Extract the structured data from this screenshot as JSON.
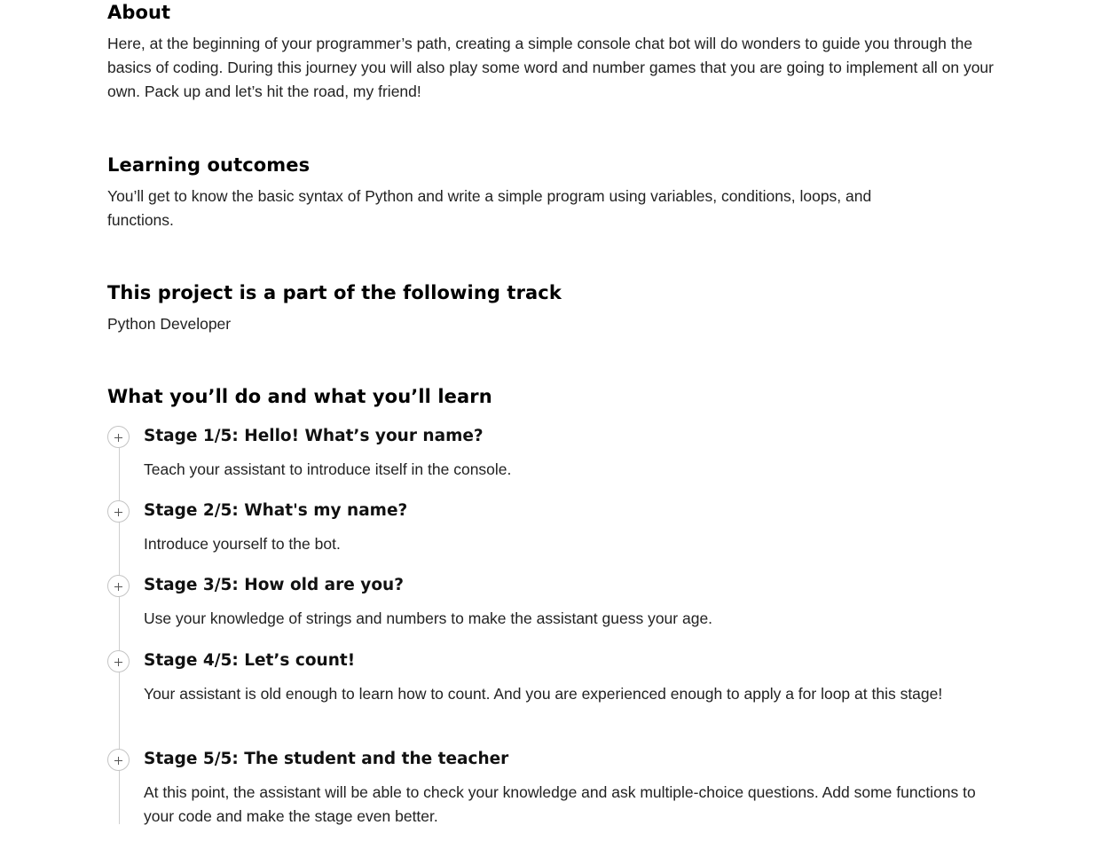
{
  "about": {
    "heading": "About",
    "text": "Here, at the beginning of your programmer’s path, creating a simple console chat bot will do wonders to guide you through the basics of coding. During this journey you will also play some word and number games that you are going to implement all on your own. Pack up and let’s hit the road, my friend!"
  },
  "outcomes": {
    "heading": "Learning outcomes",
    "text": "You’ll get to know the basic syntax of Python and write a simple program using variables, conditions, loops, and functions."
  },
  "track": {
    "heading": "This project is a part of the following track",
    "name": "Python Developer"
  },
  "stages": {
    "heading": "What you’ll do and what you’ll learn",
    "toggle_icon": "plus-circle-icon",
    "items": [
      {
        "title": "Stage 1/5: Hello! What’s your name?",
        "description": "Teach your assistant to introduce itself in the console."
      },
      {
        "title": "Stage 2/5: What's my name?",
        "description": "Introduce yourself to the bot."
      },
      {
        "title": "Stage 3/5: How old are you?",
        "description": "Use your knowledge of strings and numbers to make the assistant guess your age."
      },
      {
        "title": "Stage 4/5: Let’s count!",
        "description": "Your assistant is old enough to learn how to count. And you are experienced enough to apply a for loop at this stage!"
      },
      {
        "title": "Stage 5/5: The student and the teacher",
        "description": "At this point, the assistant will be able to check your knowledge and ask multiple-choice questions. Add some functions to your code and make the stage even better."
      }
    ]
  }
}
